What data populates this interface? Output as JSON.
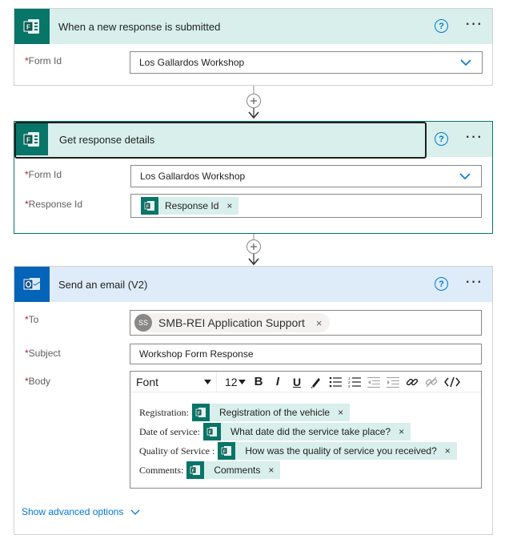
{
  "colors": {
    "forms_teal": "#077568",
    "outlook_blue": "#0364b8",
    "header_teal_bg": "#d8efeb",
    "header_blue_bg": "#deecf9",
    "link_blue": "#0078d4",
    "required_red": "#a4262c"
  },
  "trigger": {
    "title": "When a new response is submitted",
    "icon": "forms-icon",
    "fields": {
      "form_id_label": "Form Id",
      "form_id_value": "Los Gallardos Workshop"
    }
  },
  "get_response": {
    "title": "Get response details",
    "icon": "forms-icon",
    "fields": {
      "form_id_label": "Form Id",
      "form_id_value": "Los Gallardos Workshop",
      "response_id_label": "Response Id",
      "response_id_token": "Response Id"
    }
  },
  "send_email": {
    "title": "Send an email (V2)",
    "icon": "outlook-icon",
    "to_label": "To",
    "to_avatar": "SS",
    "to_value": "SMB-REI Application Support",
    "subject_label": "Subject",
    "subject_value": "Workshop Form Response",
    "body_label": "Body",
    "toolbar": {
      "font": "Font",
      "size": "12"
    },
    "body_lines": [
      {
        "label": "Registration:",
        "token": "Registration of the vehicle"
      },
      {
        "label": "Date of service:",
        "token": "What date did the service take place?"
      },
      {
        "label": "Quality of Service :",
        "token": "How was the quality of service you received?"
      },
      {
        "label": "Comments:",
        "token": "Comments"
      }
    ],
    "advanced_link": "Show advanced options"
  },
  "common": {
    "help_glyph": "?",
    "more_glyph": "···",
    "required_mark": "*",
    "remove_glyph": "×"
  }
}
